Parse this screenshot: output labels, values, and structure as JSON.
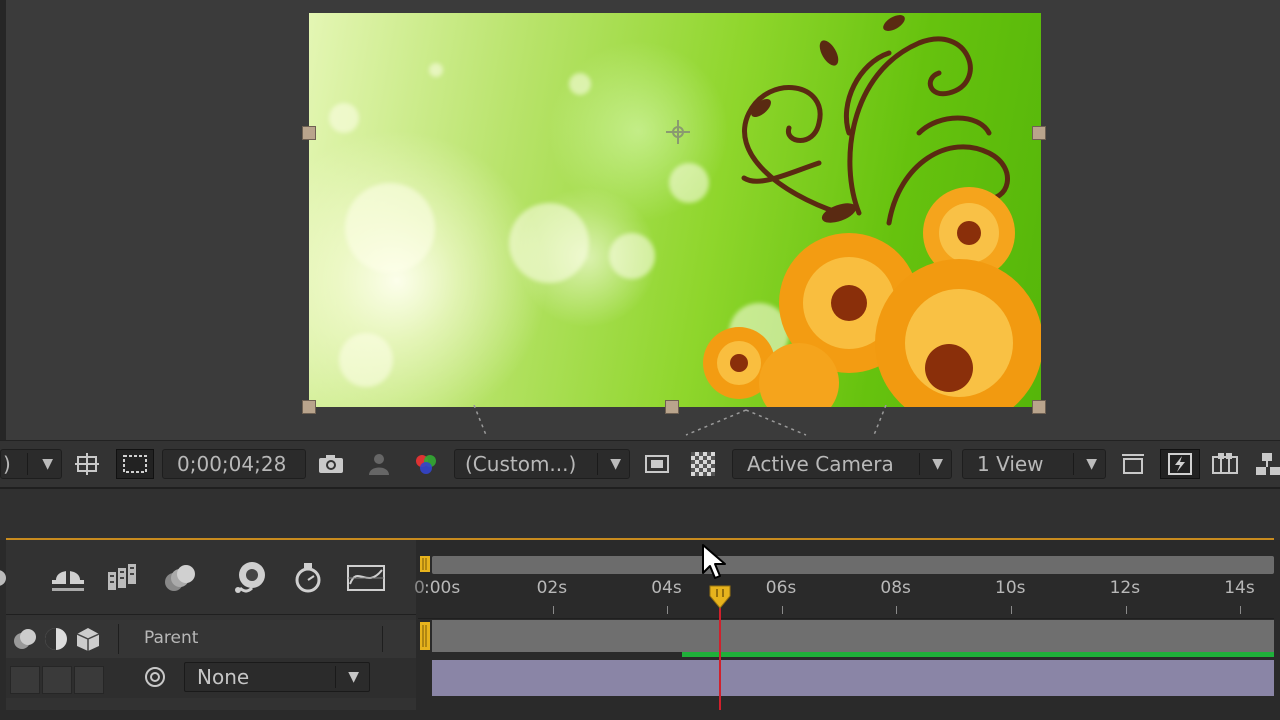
{
  "viewer": {
    "timecode": "0;00;04;28",
    "resolution_label": "(Custom...)",
    "camera_label": "Active Camera",
    "view_label": "1 View",
    "zoom_fragment": ")"
  },
  "icons": {
    "viewer_toolbar": [
      "dropdown-arrow-icon",
      "region-of-interest-icon",
      "transparency-grid-icon",
      "camera-snapshot-icon",
      "show-snapshot-icon",
      "color-channels-icon",
      "toggle-mask-icon",
      "checkerboard-icon",
      "pixel-aspect-icon",
      "fast-previews-icon",
      "flowchart-icon",
      "comp-flowchart-icon"
    ],
    "timeline_switches": [
      "draft-3d-icon",
      "hide-shy-layers-icon",
      "frame-blending-icon",
      "motion-blur-icon",
      "brainstorm-icon",
      "stopwatch-icon",
      "graph-editor-icon"
    ]
  },
  "timeline": {
    "header": {
      "parent_label": "Parent"
    },
    "layer": {
      "parent_value": "None"
    },
    "ruler": {
      "labels": [
        ":00s",
        "02s",
        "04s",
        "06s",
        "08s",
        "10s",
        "12s",
        "14s"
      ],
      "seconds": [
        0,
        2,
        4,
        6,
        8,
        10,
        12,
        14
      ],
      "zero_prefix": "0"
    },
    "current_time_seconds": 4.93
  },
  "colors": {
    "playhead": "#d0202c",
    "playhead_head": "#e7b31d",
    "work_area_line": "#c88b1e",
    "layer_bar": "#8a85a6",
    "audio_bar": "#1fb03a"
  }
}
